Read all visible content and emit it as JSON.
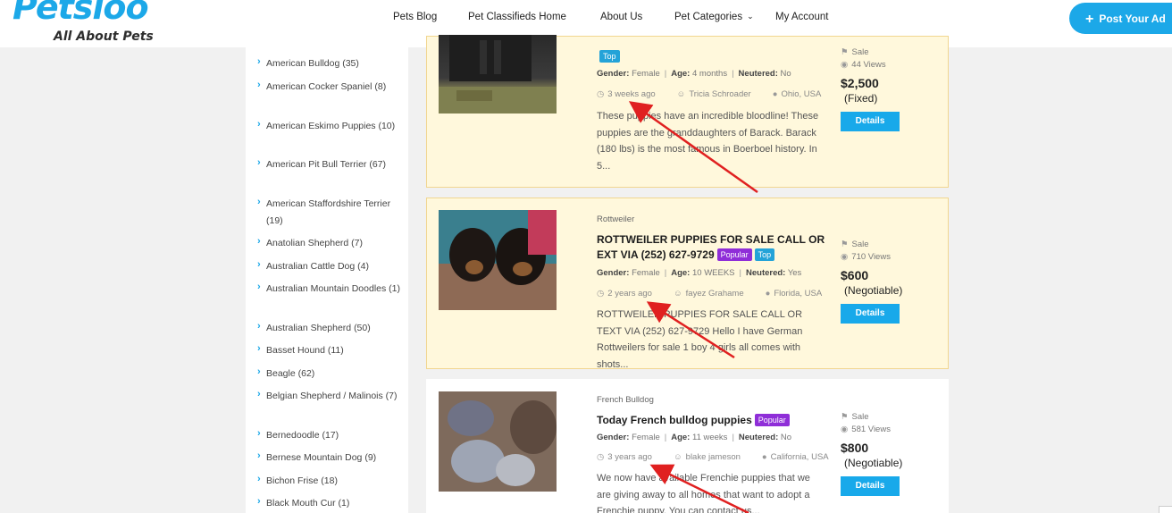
{
  "logo": {
    "main": "Petsloo",
    "tagline": "All About Pets"
  },
  "nav": {
    "items": [
      {
        "label": "Pets Blog"
      },
      {
        "label": "Pet Classifieds Home"
      },
      {
        "label": "About Us"
      },
      {
        "label": "Pet Categories"
      },
      {
        "label": "My Account"
      }
    ],
    "post_ad": "Post Your Ad"
  },
  "sidebar": {
    "categories": [
      {
        "label": "American Bulldog (35)"
      },
      {
        "label": "American Cocker Spaniel (8)"
      },
      {
        "label": "American Eskimo Puppies (10)"
      },
      {
        "label": "American Pit Bull Terrier (67)"
      },
      {
        "label": "American Staffordshire Terrier (19)"
      },
      {
        "label": "Anatolian Shepherd (7)"
      },
      {
        "label": "Australian Cattle Dog (4)"
      },
      {
        "label": "Australian Mountain Doodles (1)"
      },
      {
        "label": "Australian Shepherd (50)"
      },
      {
        "label": "Basset Hound (11)"
      },
      {
        "label": "Beagle (62)"
      },
      {
        "label": "Belgian Shepherd / Malinois (7)"
      },
      {
        "label": "Bernedoodle (17)"
      },
      {
        "label": "Bernese Mountain Dog (9)"
      },
      {
        "label": "Bichon Frise (18)"
      },
      {
        "label": "Black Mouth Cur (1)"
      }
    ]
  },
  "listings": [
    {
      "category": "",
      "title": "",
      "badges": [
        "Top"
      ],
      "gender_label": "Gender:",
      "gender": "Female",
      "age_label": "Age:",
      "age": "4 months",
      "neutered_label": "Neutered:",
      "neutered": "No",
      "time": "3 weeks ago",
      "seller": "Tricia Schroader",
      "location": "Ohio, USA",
      "description": "These puppies have an incredible bloodline! These puppies are the granddaughters of Barack. Barack (180 lbs) is the most famous in Boerboel history. In 5...",
      "ad_type": "Sale",
      "views": "44 Views",
      "price": "$2,500",
      "price_type": "(Fixed)",
      "details": "Details"
    },
    {
      "category": "Rottweiler",
      "title": "ROTTWEILER PUPPIES FOR SALE CALL OR EXT VIA (252) 627-9729",
      "badges": [
        "Popular",
        "Top"
      ],
      "gender_label": "Gender:",
      "gender": "Female",
      "age_label": "Age:",
      "age": "10 WEEKS",
      "neutered_label": "Neutered:",
      "neutered": "Yes",
      "time": "2 years ago",
      "seller": "fayez Grahame",
      "location": "Florida, USA",
      "description": "ROTTWEILER PUPPIES FOR SALE CALL OR TEXT VIA (252) 627-9729 Hello I have German Rottweilers for sale 1 boy 4 girls all comes with shots...",
      "ad_type": "Sale",
      "views": "710 Views",
      "price": "$600",
      "price_type": "(Negotiable)",
      "details": "Details"
    },
    {
      "category": "French Bulldog",
      "title": "Today French bulldog puppies",
      "badges": [
        "Popular"
      ],
      "gender_label": "Gender:",
      "gender": "Female",
      "age_label": "Age:",
      "age": "11 weeks",
      "neutered_label": "Neutered:",
      "neutered": "No",
      "time": "3 years ago",
      "seller": "blake jameson",
      "location": "California, USA",
      "description": "We now have available Frenchie puppies that we are giving away to all homes that want to adopt a Frenchie puppy. You can contact us...",
      "ad_type": "Sale",
      "views": "581 Views",
      "price": "$800",
      "price_type": "(Negotiable)",
      "details": "Details"
    }
  ],
  "colors": {
    "accent": "#1ca8e8",
    "featured_bg": "#fff8dc",
    "popular": "#8f2ed8",
    "top": "#24a3d8",
    "arrow": "#e02020"
  }
}
